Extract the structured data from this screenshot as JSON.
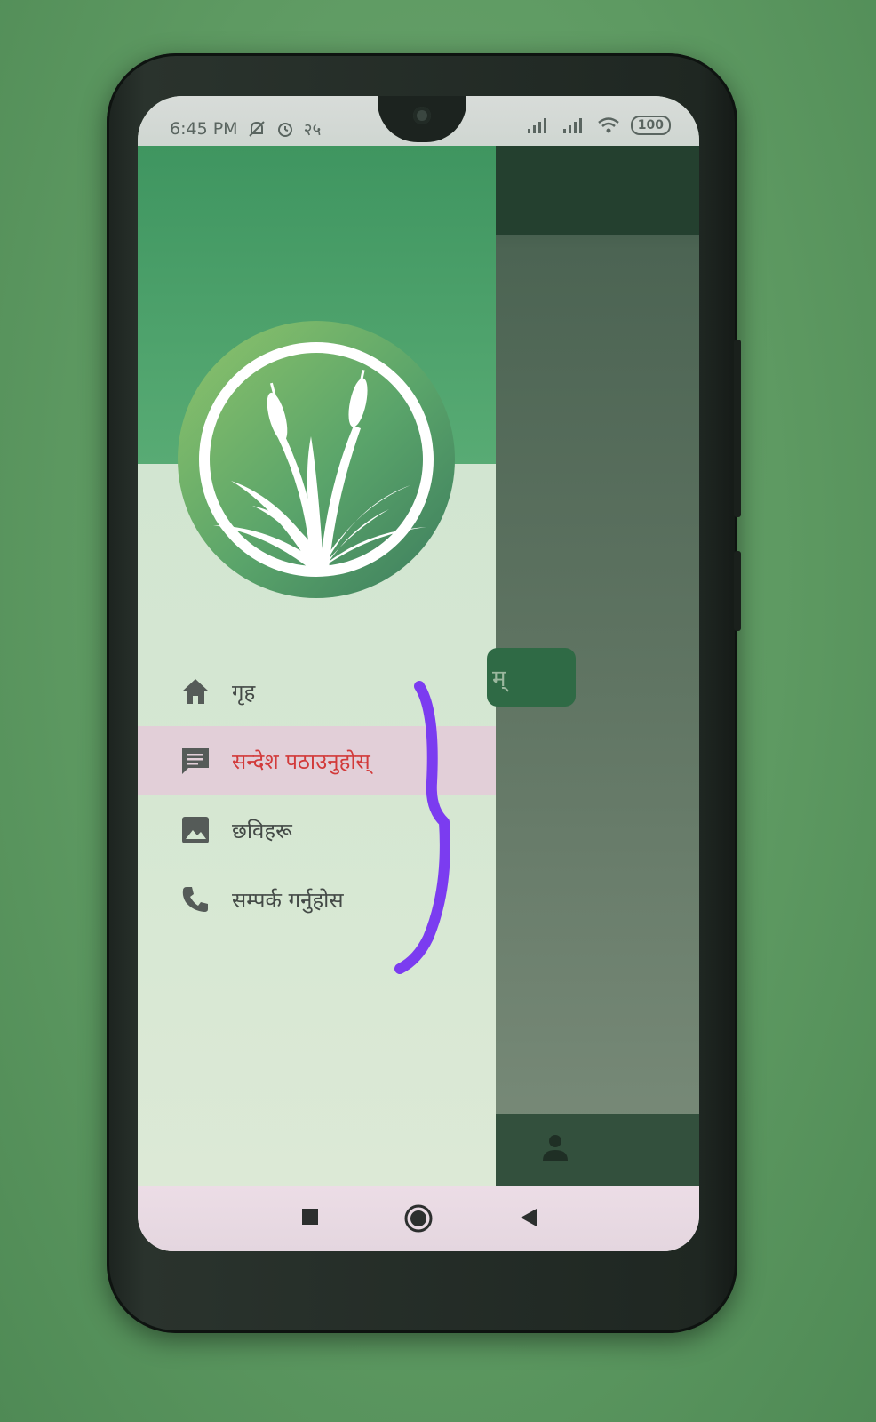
{
  "status_bar": {
    "time": "6:45 PM",
    "notification_count": "२५",
    "battery": "100"
  },
  "drawer": {
    "menu": [
      {
        "label": "गृह",
        "icon": "home-icon"
      },
      {
        "label": "सन्देश पठाउनुहोस्",
        "icon": "message-icon",
        "active": true
      },
      {
        "label": "छविहरू",
        "icon": "image-icon"
      },
      {
        "label": "सम्पर्क गर्नुहोस",
        "icon": "phone-icon"
      }
    ]
  },
  "background_app": {
    "button_partial_text": "म्"
  },
  "colors": {
    "drawer_header": "#4fa46c",
    "active_item_text": "#d23a3a",
    "active_item_bg": "#e2cfd8",
    "annotation_stroke": "#7b3cf0"
  }
}
